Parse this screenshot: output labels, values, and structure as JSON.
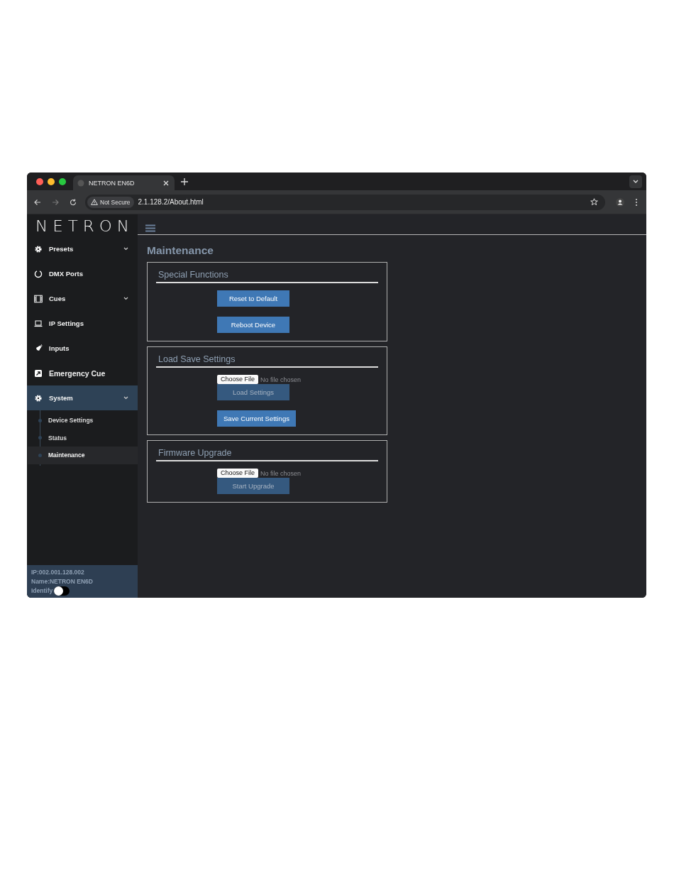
{
  "browser": {
    "tab_title": "NETRON EN6D",
    "security": "Not Secure",
    "url": "2.1.128.2/About.html"
  },
  "sidebar": {
    "logo": "NETRON",
    "items": [
      {
        "label": "Presets",
        "kind": "gear",
        "submenu": true,
        "selected": false
      },
      {
        "label": "DMX Ports",
        "kind": "ring",
        "submenu": false,
        "selected": false
      },
      {
        "label": "Cues",
        "kind": "film",
        "submenu": true,
        "selected": false
      },
      {
        "label": "IP Settings",
        "kind": "laptop",
        "submenu": false,
        "selected": false
      },
      {
        "label": "Inputs",
        "kind": "plug",
        "submenu": false,
        "selected": false
      },
      {
        "label": "Emergency Cue",
        "kind": "arrow",
        "submenu": false,
        "selected": false
      },
      {
        "label": "System",
        "kind": "gear",
        "submenu": true,
        "selected": true,
        "children": [
          {
            "label": "Device Settings",
            "selected": false
          },
          {
            "label": "Status",
            "selected": false
          },
          {
            "label": "Maintenance",
            "selected": true
          }
        ]
      }
    ],
    "footer": {
      "ip": "IP:002.001.128.002",
      "name": "Name:NETRON EN6D",
      "identify_label": "Identify",
      "identify_on": false
    }
  },
  "main": {
    "title": "Maintenance",
    "sections": [
      {
        "title": "Special Functions",
        "controls": [
          {
            "kind": "button",
            "label": "Reset to Default",
            "disabled": false
          },
          {
            "kind": "button",
            "label": "Reboot Device",
            "disabled": false
          }
        ]
      },
      {
        "title": "Load Save Settings",
        "controls": [
          {
            "kind": "file",
            "button_label": "Choose File",
            "status": "No file chosen"
          },
          {
            "kind": "button",
            "label": "Load Settings",
            "disabled": true
          },
          {
            "kind": "button",
            "label": "Save Current Settings",
            "disabled": false
          }
        ]
      },
      {
        "title": "Firmware Upgrade",
        "controls": [
          {
            "kind": "file",
            "button_label": "Choose File",
            "status": "No file chosen"
          },
          {
            "kind": "button",
            "label": "Start Upgrade",
            "disabled": true
          }
        ]
      }
    ]
  }
}
